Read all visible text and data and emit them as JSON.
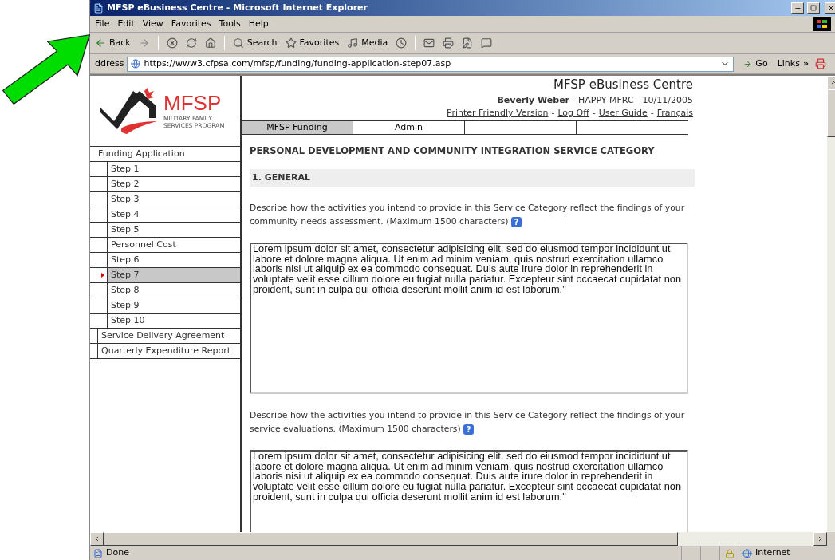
{
  "window": {
    "title": "MFSP eBusiness Centre - Microsoft Internet Explorer"
  },
  "menu": [
    "File",
    "Edit",
    "View",
    "Favorites",
    "Tools",
    "Help"
  ],
  "toolbar": [
    {
      "kind": "back",
      "label": "Back"
    },
    {
      "kind": "forward"
    },
    {
      "kind": "separator"
    },
    {
      "kind": "stop"
    },
    {
      "kind": "refresh"
    },
    {
      "kind": "home"
    },
    {
      "kind": "separator"
    },
    {
      "kind": "search",
      "label": "Search"
    },
    {
      "kind": "favorites",
      "label": "Favorites"
    },
    {
      "kind": "media",
      "label": "Media"
    },
    {
      "kind": "history"
    },
    {
      "kind": "separator"
    },
    {
      "kind": "mail"
    },
    {
      "kind": "print"
    },
    {
      "kind": "edit"
    },
    {
      "kind": "discuss"
    }
  ],
  "address": {
    "label": "ddress",
    "url": "https://www3.cfpsa.com/mfsp/funding/funding-application-step07.asp",
    "go": "Go",
    "links": "Links",
    "links_more": "»"
  },
  "logo": {
    "name": "MFSP",
    "subtitle": "MILITARY FAMILY SERVICES PROGRAM"
  },
  "header": {
    "title": "MFSP eBusiness Centre",
    "user_line": "**Beverly Weber** - HAPPY MFRC - 10/11/2005",
    "links": [
      {
        "kind": "link",
        "text": "Printer Friendly Version"
      },
      {
        "kind": "separator",
        "text": "-"
      },
      {
        "kind": "link",
        "text": "Log Off"
      },
      {
        "kind": "separator",
        "text": "-"
      },
      {
        "kind": "link",
        "text": "User Guide"
      },
      {
        "kind": "separator",
        "text": "-"
      },
      {
        "kind": "link",
        "text": "Français"
      }
    ]
  },
  "tabs": [
    {
      "label": "MFSP Funding",
      "selected": true
    },
    {
      "label": "Admin",
      "selected": false
    }
  ],
  "sidebar": {
    "items": [
      {
        "label": "Funding Application",
        "selected": false,
        "children": [
          {
            "label": "Step 1",
            "selected": false
          },
          {
            "label": "Step 2",
            "selected": false
          },
          {
            "label": "Step 3",
            "selected": false
          },
          {
            "label": "Step 4",
            "selected": false
          },
          {
            "label": "Step 5",
            "selected": false
          },
          {
            "label": "Personnel Cost",
            "selected": false
          },
          {
            "label": "Step 6",
            "selected": false
          },
          {
            "label": "Step 7",
            "selected": true
          },
          {
            "label": "Step 8",
            "selected": false
          },
          {
            "label": "Step 9",
            "selected": false
          },
          {
            "label": "Step 10",
            "selected": false
          }
        ]
      },
      {
        "label": "Service Delivery Agreement",
        "selected": false
      },
      {
        "label": "Quarterly Expenditure Report",
        "selected": false
      }
    ]
  },
  "content": {
    "help_mark": "?",
    "heading": "PERSONAL DEVELOPMENT AND COMMUNITY INTEGRATION SERVICE CATEGORY",
    "section": "1. GENERAL",
    "questions": [
      {
        "prompt": "Describe how the activities you intend to provide in this Service Category reflect the findings of your community needs assessment. (Maximum 1500 characters)",
        "answer": "Lorem ipsum dolor sit amet, consectetur adipisicing elit, sed do eiusmod tempor incididunt ut labore et dolore magna aliqua. Ut enim ad minim veniam, quis nostrud exercitation ullamco laboris nisi ut aliquip ex ea commodo consequat. Duis aute irure dolor in reprehenderit in voluptate velit esse cillum dolore eu fugiat nulla pariatur. Excepteur sint occaecat cupidatat non proident, sunt in culpa qui officia deserunt mollit anim id est laborum.\""
      },
      {
        "prompt": "Describe how the activities you intend to provide in this Service Category reflect the findings of your service evaluations. (Maximum 1500 characters)",
        "answer": "Lorem ipsum dolor sit amet, consectetur adipisicing elit, sed do eiusmod tempor incididunt ut labore et dolore magna aliqua. Ut enim ad minim veniam, quis nostrud exercitation ullamco laboris nisi ut aliquip ex ea commodo consequat. Duis aute irure dolor in reprehenderit in voluptate velit esse cillum dolore eu fugiat nulla pariatur. Excepteur sint occaecat cupidatat non proident, sunt in culpa qui officia deserunt mollit anim id est laborum.\""
      }
    ]
  },
  "status_bar": {
    "text": "Done",
    "secure": true,
    "zone": "Internet"
  }
}
